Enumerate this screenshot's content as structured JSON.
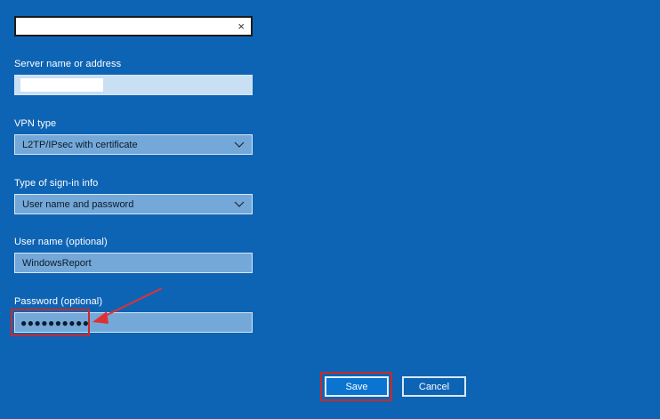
{
  "form": {
    "top_field": {
      "value": "",
      "clear_icon": "×"
    },
    "server": {
      "label": "Server name or address",
      "value": ""
    },
    "vpn_type": {
      "label": "VPN type",
      "value": "L2TP/IPsec with certificate"
    },
    "signin": {
      "label": "Type of sign-in info",
      "value": "User name and password"
    },
    "username": {
      "label": "User name (optional)",
      "value": "WindowsReport"
    },
    "password": {
      "label": "Password (optional)",
      "value": "●●●●●●●●●●"
    }
  },
  "buttons": {
    "save_label": "Save",
    "cancel_label": "Cancel"
  },
  "colors": {
    "background": "#0e64b4",
    "field": "#74a8d8",
    "highlight": "#c92a2a",
    "arrow": "#e03131"
  },
  "icons": {
    "clear": "close-icon",
    "dropdown": "chevron-down-icon",
    "annotation": "arrow-annotation"
  }
}
